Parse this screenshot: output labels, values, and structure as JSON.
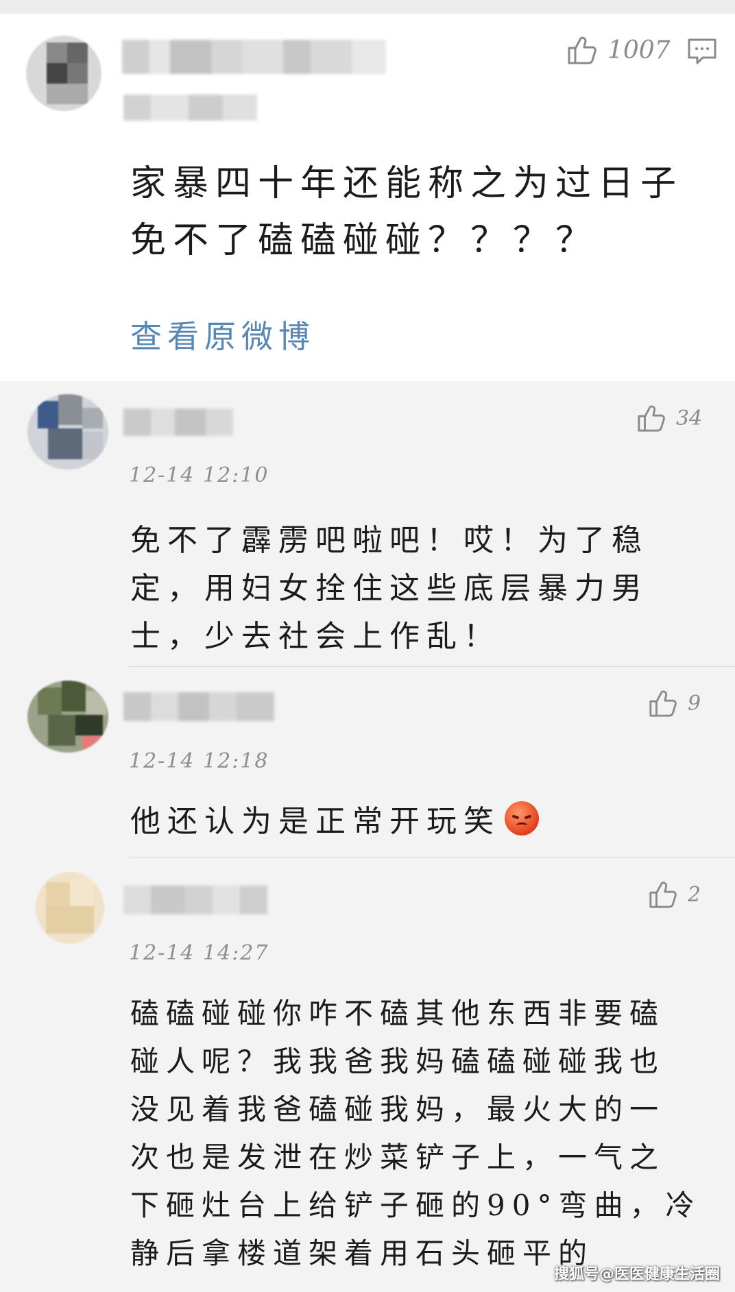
{
  "main_comment": {
    "like_count": "1007",
    "text_line1": "家暴四十年还能称之为过日子",
    "text_line2": "免不了磕磕碰碰？？？？",
    "view_original": "查看原微博"
  },
  "replies": [
    {
      "like_count": "34",
      "time": "12-14 12:10",
      "lines": [
        "免不了霹雳吧啦吧！哎！为了稳",
        "定，用妇女拴住这些底层暴力男",
        "士，少去社会上作乱！"
      ]
    },
    {
      "like_count": "9",
      "time": "12-14 12:18",
      "lines": [
        "他还认为是正常开玩笑"
      ],
      "emoji": "angry-face-emoji"
    },
    {
      "like_count": "2",
      "time": "12-14 14:27",
      "lines": [
        "磕磕碰碰你咋不磕其他东西非要磕",
        "碰人呢？我我爸我妈磕磕碰碰我也",
        "没见着我爸磕碰我妈，最火大的一",
        "次也是发泄在炒菜铲子上，一气之",
        "下砸灶台上给铲子砸的90°弯曲，冷",
        "静后拿楼道架着用石头砸平的"
      ]
    }
  ],
  "icons": {
    "like": "thumbs-up-icon",
    "comment": "comment-icon"
  },
  "watermark": "搜狐号@医医健康生活圈",
  "colors": {
    "link": "#5a86b3",
    "text": "#1b1b1b",
    "meta": "#8f8f8f",
    "card": "#ffffff",
    "page": "#f3f3f3"
  }
}
